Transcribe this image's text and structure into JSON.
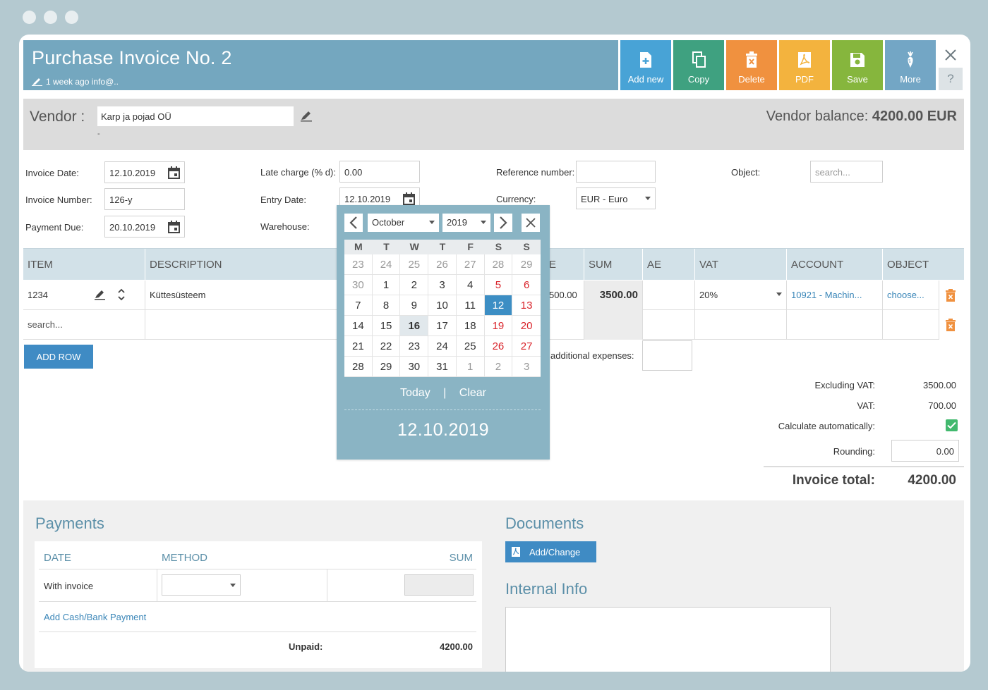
{
  "header": {
    "title": "Purchase Invoice No. 2",
    "meta": "1 week ago info@..",
    "buttons": {
      "add_new": "Add new",
      "copy": "Copy",
      "delete": "Delete",
      "pdf": "PDF",
      "save": "Save",
      "more": "More"
    },
    "help": "?"
  },
  "vendor": {
    "label": "Vendor :",
    "value": "Karp ja pojad OÜ",
    "sub": "-",
    "balance_label": "Vendor balance:",
    "balance_value": "4200.00 EUR"
  },
  "form": {
    "invoice_date_label": "Invoice Date:",
    "invoice_date": "12.10.2019",
    "invoice_number_label": "Invoice Number:",
    "invoice_number": "126-y",
    "payment_due_label": "Payment Due:",
    "payment_due": "20.10.2019",
    "late_charge_label": "Late charge (% d):",
    "late_charge": "0.00",
    "entry_date_label": "Entry Date:",
    "entry_date": "12.10.2019",
    "warehouse_label": "Warehouse:",
    "reference_label": "Reference number:",
    "reference": "",
    "currency_label": "Currency:",
    "currency": "EUR - Euro",
    "object_label": "Object:",
    "object_placeholder": "search..."
  },
  "table": {
    "headers": {
      "item": "ITEM",
      "description": "DESCRIPTION",
      "price_partial": "E",
      "sum": "SUM",
      "ae": "AE",
      "vat": "VAT",
      "account": "ACCOUNT",
      "object": "OBJECT"
    },
    "row1": {
      "item": "1234",
      "description": "Küttesüsteem",
      "price_partial": "500.00",
      "sum": "3500.00",
      "vat": "20%",
      "account": "10921 - Machin...",
      "object": "choose..."
    },
    "row2": {
      "item_placeholder": "search..."
    },
    "add_row": "ADD ROW",
    "additional_expenses": "additional expenses:"
  },
  "totals": {
    "excluding_vat_label": "Excluding VAT:",
    "excluding_vat": "3500.00",
    "vat_label": "VAT:",
    "vat": "700.00",
    "calc_label": "Calculate automatically:",
    "rounding_label": "Rounding:",
    "rounding": "0.00",
    "total_label": "Invoice total:",
    "total": "4200.00"
  },
  "payments": {
    "title": "Payments",
    "col_date": "DATE",
    "col_method": "METHOD",
    "col_sum": "SUM",
    "row_label": "With invoice",
    "add_link": "Add Cash/Bank Payment",
    "unpaid_label": "Unpaid:",
    "unpaid": "4200.00"
  },
  "documents": {
    "title": "Documents",
    "button": "Add/Change"
  },
  "internal_info": {
    "title": "Internal Info"
  },
  "datepicker": {
    "month": "October",
    "year": "2019",
    "weekdays": [
      "M",
      "T",
      "W",
      "T",
      "F",
      "S",
      "S"
    ],
    "days": [
      "23",
      "24",
      "25",
      "26",
      "27",
      "28",
      "29",
      "30",
      "1",
      "2",
      "3",
      "4",
      "5",
      "6",
      "7",
      "8",
      "9",
      "10",
      "11",
      "12",
      "13",
      "14",
      "15",
      "16",
      "17",
      "18",
      "19",
      "20",
      "21",
      "22",
      "23",
      "24",
      "25",
      "26",
      "27",
      "28",
      "29",
      "30",
      "31",
      "1",
      "2",
      "3"
    ],
    "today_label": "Today",
    "divider": "|",
    "clear_label": "Clear",
    "selected_date": "12.10.2019"
  },
  "colors": {
    "header_blue": "#74a7bf",
    "add_new": "#48a3d6",
    "copy": "#3fa180",
    "delete": "#f0913f",
    "pdf": "#f3b33e",
    "save": "#86b63d",
    "more": "#73a6c5",
    "primary": "#3f8bc4",
    "weekend": "#d9232a"
  },
  "icons": {
    "add_new": "file-plus-icon",
    "copy": "copy-icon",
    "delete": "trash-icon",
    "pdf": "pdf-icon",
    "save": "floppy-icon",
    "more": "carrot-icon"
  }
}
